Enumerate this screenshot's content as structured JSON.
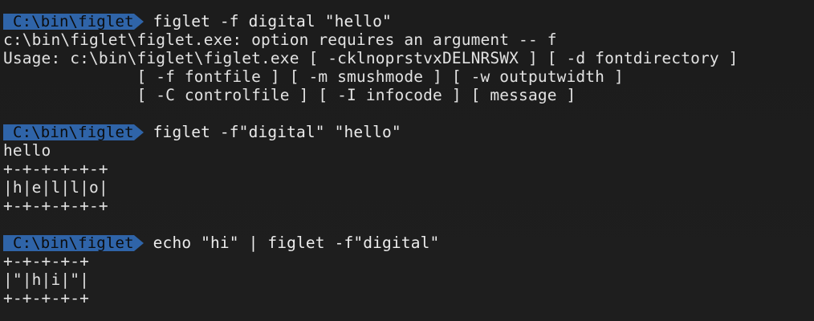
{
  "terminal": {
    "blocks": [
      {
        "prompt": "C:\\bin\\figlet",
        "command": "figlet -f digital \"hello\"",
        "output": [
          "c:\\bin\\figlet\\figlet.exe: option requires an argument -- f",
          "Usage: c:\\bin\\figlet\\figlet.exe [ -cklnoprstvxDELNRSWX ] [ -d fontdirectory ]",
          "              [ -f fontfile ] [ -m smushmode ] [ -w outputwidth ]",
          "              [ -C controlfile ] [ -I infocode ] [ message ]"
        ]
      },
      {
        "prompt": "C:\\bin\\figlet",
        "command": "figlet -f\"digital\" \"hello\"",
        "output": [
          "hello",
          "+-+-+-+-+-+",
          "|h|e|l|l|o|",
          "+-+-+-+-+-+"
        ]
      },
      {
        "prompt": "C:\\bin\\figlet",
        "command": "echo \"hi\" | figlet -f\"digital\"",
        "output": [
          "+-+-+-+-+",
          "|\"|h|i|\"|",
          "+-+-+-+-+"
        ]
      }
    ],
    "colors": {
      "background": "#1e1e1e",
      "prompt_bg": "#2f64a8",
      "prompt_text": "#0c0c0c",
      "text": "#e6e6e6"
    }
  }
}
